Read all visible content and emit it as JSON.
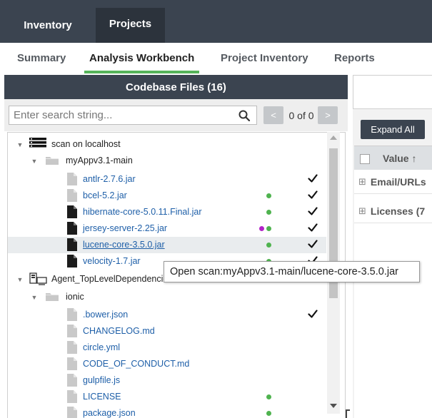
{
  "top_tabs": [
    {
      "label": "Inventory",
      "active": false
    },
    {
      "label": "Projects",
      "active": true
    }
  ],
  "sub_tabs": [
    {
      "label": "Summary",
      "active": false
    },
    {
      "label": "Analysis Workbench",
      "active": true
    },
    {
      "label": "Project Inventory",
      "active": false
    },
    {
      "label": "Reports",
      "active": false
    }
  ],
  "codebase": {
    "title": "Codebase Files (16)",
    "search_placeholder": "Enter search string...",
    "match_count": "0 of 0",
    "prev_symbol": "<",
    "next_symbol": ">"
  },
  "tree": [
    {
      "label": "scan on localhost",
      "kind": "server",
      "level": 0
    },
    {
      "label": "myAppv3.1-main",
      "kind": "folder",
      "level": 1
    },
    {
      "label": "antlr-2.7.6.jar",
      "kind": "file-light",
      "level": 2,
      "dots": [],
      "checked": true
    },
    {
      "label": "bcel-5.2.jar",
      "kind": "file-light",
      "level": 2,
      "dots": [
        "green"
      ],
      "checked": true
    },
    {
      "label": "hibernate-core-5.0.11.Final.jar",
      "kind": "file-dark",
      "level": 2,
      "dots": [
        "green"
      ],
      "checked": true
    },
    {
      "label": "jersey-server-2.25.jar",
      "kind": "file-dark",
      "level": 2,
      "dots": [
        "magenta",
        "green"
      ],
      "checked": true
    },
    {
      "label": "lucene-core-3.5.0.jar",
      "kind": "file-dark",
      "level": 2,
      "dots": [
        "green"
      ],
      "checked": true,
      "selected": true
    },
    {
      "label": "velocity-1.7.jar",
      "kind": "file-dark",
      "level": 2,
      "dots": [
        "green"
      ],
      "checked": true
    },
    {
      "label": "Agent_TopLevelDependencies",
      "kind": "agent",
      "level": 0
    },
    {
      "label": "ionic",
      "kind": "folder",
      "level": 1
    },
    {
      "label": ".bower.json",
      "kind": "file-light",
      "level": 2,
      "dots": [],
      "checked": true
    },
    {
      "label": "CHANGELOG.md",
      "kind": "file-light",
      "level": 2,
      "dots": [],
      "checked": false
    },
    {
      "label": "circle.yml",
      "kind": "file-light",
      "level": 2,
      "dots": [],
      "checked": false
    },
    {
      "label": "CODE_OF_CONDUCT.md",
      "kind": "file-light",
      "level": 2,
      "dots": [],
      "checked": false
    },
    {
      "label": "gulpfile.js",
      "kind": "file-light",
      "level": 2,
      "dots": [],
      "checked": false
    },
    {
      "label": "LICENSE",
      "kind": "file-light",
      "level": 2,
      "dots": [
        "green"
      ],
      "checked": false
    },
    {
      "label": "package.json",
      "kind": "file-light",
      "level": 2,
      "dots": [
        "green"
      ],
      "checked": false
    }
  ],
  "tooltip": "Open scan:myAppv3.1-main/lucene-core-3.5.0.jar",
  "right_panel": {
    "expand_all_label": "Expand All",
    "column_header": "Value ↑",
    "groups": [
      "Email/URLs",
      "Licenses (7"
    ]
  },
  "colors": {
    "dark_header": "#3b4450",
    "active_tab": "#2c333c",
    "accent_green": "#56b45a",
    "link_blue": "#1e5fa8",
    "dot_green": "#4fb34f",
    "dot_magenta": "#b223c8"
  }
}
